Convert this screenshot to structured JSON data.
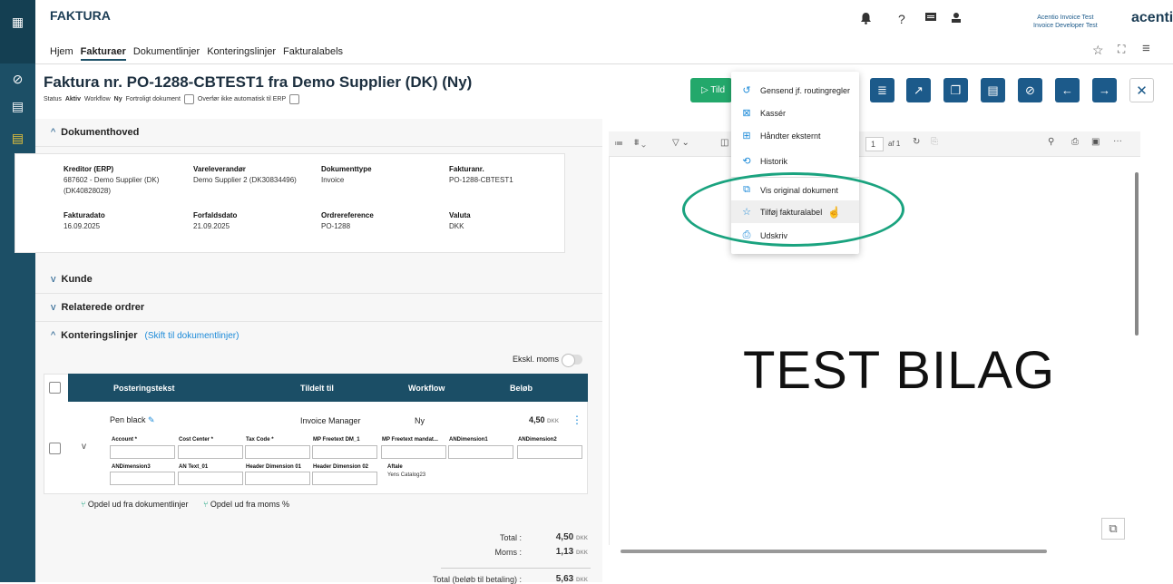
{
  "app": {
    "name": "FAKTURA",
    "brand": "acentio"
  },
  "nav": [
    "Hjem",
    "Fakturaer",
    "Dokumentlinjer",
    "Konteringslinjer",
    "Fakturalabels"
  ],
  "user": {
    "line1": "Acentio Invoice Test",
    "line2": "Invoice Developer Test"
  },
  "doc": {
    "title": "Faktura nr. PO-1288-CBTEST1 fra Demo Supplier (DK) (Ny)",
    "status_label": "Status",
    "status_value": "Aktiv",
    "workflow_label": "Workflow",
    "workflow_value": "Ny",
    "confidential": "Fortroligt dokument",
    "no_erp": "Overfør ikke automatisk til ERP"
  },
  "actions": {
    "primary": "Tild"
  },
  "sections": {
    "header": "Dokumenthoved",
    "customer": "Kunde",
    "related": "Relaterede ordrer",
    "lines": "Konteringslinjer",
    "lines_link": "(Skift til dokumentlinjer)"
  },
  "fields": [
    {
      "label": "Kreditor (ERP)",
      "value": "687602 - Demo Supplier (DK) (DK40828028)"
    },
    {
      "label": "Vareleverandør",
      "value": "Demo Supplier 2 (DK30834496)"
    },
    {
      "label": "Dokumenttype",
      "value": "Invoice"
    },
    {
      "label": "Fakturanr.",
      "value": "PO-1288-CBTEST1"
    },
    {
      "label": "Fakturadato",
      "value": "16.09.2025"
    },
    {
      "label": "Forfaldsdato",
      "value": "21.09.2025"
    },
    {
      "label": "Ordrereference",
      "value": "PO-1288"
    },
    {
      "label": "Valuta",
      "value": "DKK"
    }
  ],
  "vat_toggle": "Ekskl. moms",
  "grid": {
    "columns": [
      "Posteringstekst",
      "Tildelt til",
      "Workflow",
      "Beløb"
    ],
    "row": {
      "text": "Pen black",
      "assigned": "Invoice Manager",
      "workflow": "Ny",
      "amount": "4,50",
      "currency": "DKK"
    },
    "dims1": [
      "Account *",
      "Cost Center *",
      "Tax Code *",
      "MP Freetext DM_1",
      "MP Freetext mandat...",
      "ANDimension1",
      "ANDimension2"
    ],
    "dims2": [
      "ANDimension3",
      "AN Text_01",
      "Header Dimension 01",
      "Header Dimension 02",
      "Aftale"
    ],
    "aftale_value": "Yens Catalog23"
  },
  "split": {
    "doc_lines": "Opdel ud fra dokumentlinjer",
    "vat": "Opdel ud fra moms %"
  },
  "totals": {
    "total_label": "Total :",
    "total_value": "4,50",
    "vat_label": "Moms :",
    "vat_value": "1,13",
    "pay_label": "Total (beløb til betaling) :",
    "pay_value": "5,63",
    "currency": "DKK"
  },
  "viewer": {
    "page": "1",
    "of": "af 1",
    "content": "TEST BILAG"
  },
  "menu": [
    {
      "icon": "refresh-icon",
      "label": "Gensend jf. routingregler"
    },
    {
      "icon": "discard-icon",
      "label": "Kassér"
    },
    {
      "icon": "external-icon",
      "label": "Håndter eksternt"
    },
    {
      "icon": "history-icon",
      "label": "Historik"
    },
    {
      "icon": "open-external-icon",
      "label": "Vis original dokument"
    },
    {
      "icon": "star-icon",
      "label": "Tilføj fakturalabel"
    },
    {
      "icon": "print-icon",
      "label": "Udskriv"
    }
  ],
  "colors": {
    "primary": "#1c5a8a",
    "rail": "#1c4f66",
    "green": "#23a86b",
    "highlight": "#1aa37f"
  }
}
